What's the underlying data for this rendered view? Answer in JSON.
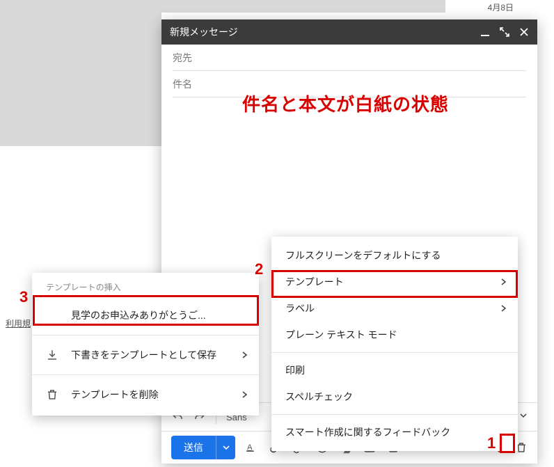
{
  "date": "4月8日",
  "terms_link": "利用規",
  "compose": {
    "title": "新規メッセージ",
    "to_placeholder": "宛先",
    "subject_placeholder": "件名",
    "font_family": "Sans",
    "send_label": "送信"
  },
  "annotation": {
    "body_blank": "件名と本文が白紙の状態",
    "num1": "1",
    "num2": "2",
    "num3": "3"
  },
  "more_menu": {
    "items": [
      {
        "label": "フルスクリーンをデフォルトにする",
        "arrow": false
      },
      {
        "label": "テンプレート",
        "arrow": true
      },
      {
        "label": "ラベル",
        "arrow": true
      },
      {
        "label": "プレーン テキスト モード",
        "arrow": false
      }
    ],
    "items2": [
      {
        "label": "印刷"
      },
      {
        "label": "スペルチェック"
      }
    ],
    "items3": [
      {
        "label": "スマート作成に関するフィードバック"
      }
    ]
  },
  "template_menu": {
    "header": "テンプレートの挿入",
    "insert_item": "見学のお申込みありがとうご...",
    "save_item": "下書きをテンプレートとして保存",
    "delete_item": "テンプレートを削除"
  }
}
